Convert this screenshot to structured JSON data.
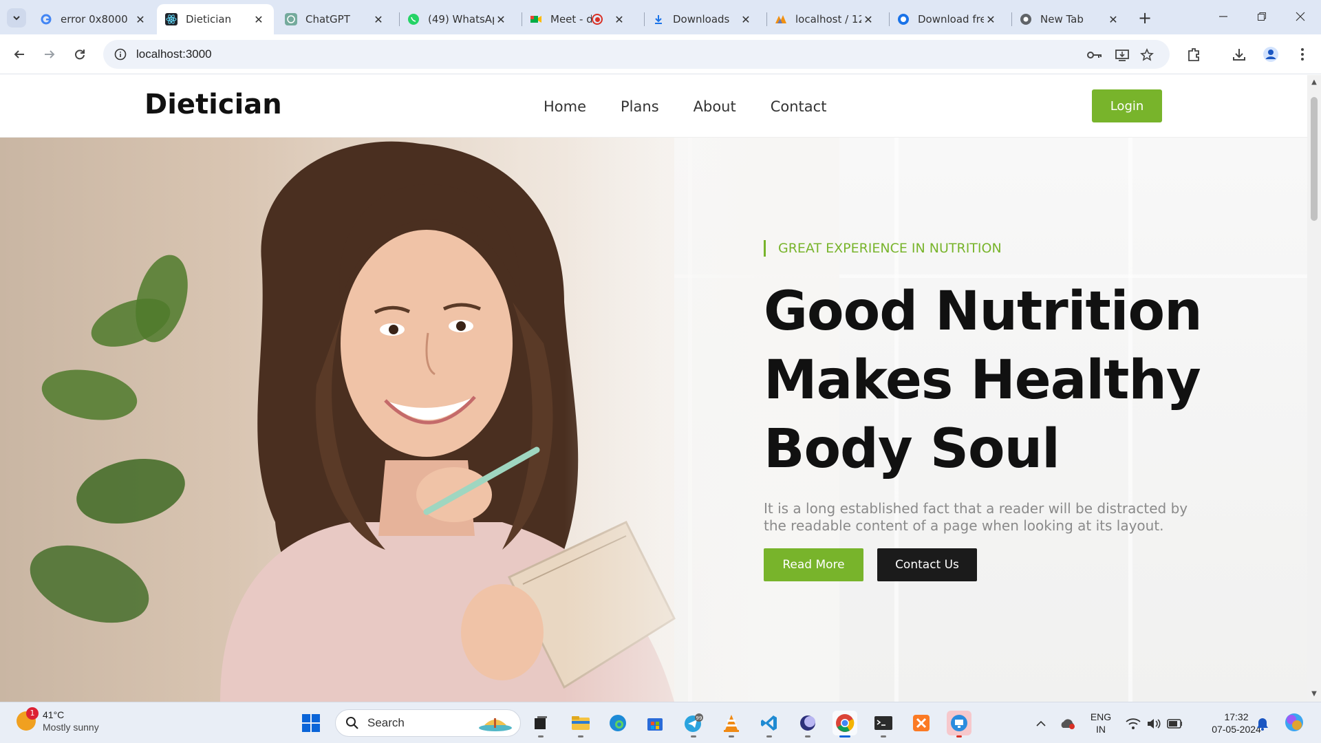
{
  "browser": {
    "tabs": [
      {
        "title": "error 0x8000",
        "icon": "google-icon",
        "active": false
      },
      {
        "title": "Dietician",
        "icon": "react-icon",
        "active": true
      },
      {
        "title": "ChatGPT",
        "icon": "chatgpt-icon",
        "active": false
      },
      {
        "title": "(49) WhatsAp",
        "icon": "whatsapp-icon",
        "active": false
      },
      {
        "title": "Meet - d",
        "icon": "meet-icon",
        "active": false
      },
      {
        "title": "Downloads",
        "icon": "download-icon",
        "active": false
      },
      {
        "title": "localhost / 12",
        "icon": "phpmyadmin-icon",
        "active": false
      },
      {
        "title": "Download fre",
        "icon": "globe-icon",
        "active": false
      },
      {
        "title": "New Tab",
        "icon": "chrome-icon",
        "active": false
      }
    ],
    "url": "localhost:3000"
  },
  "site": {
    "brand": "Dietician",
    "nav": [
      "Home",
      "Plans",
      "About",
      "Contact"
    ],
    "login_label": "Login",
    "accent_color": "#78b42b",
    "hero": {
      "eyebrow": "GREAT EXPERIENCE IN NUTRITION",
      "headline_lines": [
        "Good Nutrition",
        "Makes Healthy",
        "Body Soul"
      ],
      "lede": "It is a long established fact that a reader will be distracted by the readable content of a page when looking at its layout.",
      "primary_button": "Read More",
      "secondary_button": "Contact Us"
    }
  },
  "taskbar": {
    "weather": {
      "temp": "41°C",
      "condition": "Mostly sunny",
      "badge": "1"
    },
    "search_label": "Search",
    "language": {
      "line1": "ENG",
      "line2": "IN"
    },
    "time": "17:32",
    "date": "07-05-2024",
    "telegram_badge": "99"
  }
}
